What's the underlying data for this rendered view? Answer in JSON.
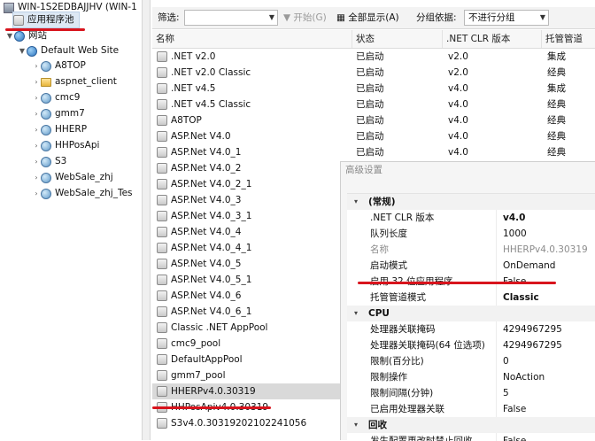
{
  "tree": {
    "server": "WIN-1S2EDBAJJHV (WIN-1",
    "app_pools": "应用程序池",
    "sites": "网站",
    "default_site": "Default Web Site",
    "children": [
      "A8TOP",
      "aspnet_client",
      "cmc9",
      "gmm7",
      "HHERP",
      "HHPosApi",
      "S3",
      "WebSale_zhj",
      "WebSale_zhj_Tes"
    ]
  },
  "toolbar": {
    "filter_label": "筛选:",
    "filter_value": "",
    "start_label": "开始(G)",
    "show_all_label": "全部显示(A)",
    "group_label": "分组依据:",
    "group_value": "不进行分组"
  },
  "columns": {
    "name": "名称",
    "status": "状态",
    "clr": ".NET CLR 版本",
    "pipeline": "托管管道"
  },
  "pools": [
    {
      "name": ".NET v2.0",
      "status": "已启动",
      "clr": "v2.0",
      "pipeline": "集成"
    },
    {
      "name": ".NET v2.0 Classic",
      "status": "已启动",
      "clr": "v2.0",
      "pipeline": "经典"
    },
    {
      "name": ".NET v4.5",
      "status": "已启动",
      "clr": "v4.0",
      "pipeline": "集成"
    },
    {
      "name": ".NET v4.5 Classic",
      "status": "已启动",
      "clr": "v4.0",
      "pipeline": "经典"
    },
    {
      "name": "A8TOP",
      "status": "已启动",
      "clr": "v4.0",
      "pipeline": "经典"
    },
    {
      "name": "ASP.Net V4.0",
      "status": "已启动",
      "clr": "v4.0",
      "pipeline": "经典"
    },
    {
      "name": "ASP.Net V4.0_1",
      "status": "已启动",
      "clr": "v4.0",
      "pipeline": "经典"
    },
    {
      "name": "ASP.Net V4.0_2"
    },
    {
      "name": "ASP.Net V4.0_2_1"
    },
    {
      "name": "ASP.Net V4.0_3"
    },
    {
      "name": "ASP.Net V4.0_3_1"
    },
    {
      "name": "ASP.Net V4.0_4"
    },
    {
      "name": "ASP.Net V4.0_4_1"
    },
    {
      "name": "ASP.Net V4.0_5"
    },
    {
      "name": "ASP.Net V4.0_5_1"
    },
    {
      "name": "ASP.Net V4.0_6"
    },
    {
      "name": "ASP.Net V4.0_6_1"
    },
    {
      "name": "Classic .NET AppPool"
    },
    {
      "name": "cmc9_pool"
    },
    {
      "name": "DefaultAppPool"
    },
    {
      "name": "gmm7_pool"
    },
    {
      "name": "HHERPv4.0.30319"
    },
    {
      "name": "HHPosApiv4.0.30319"
    },
    {
      "name": "S3v4.0.30319202102241056"
    }
  ],
  "selected_pool": "HHERPv4.0.30319",
  "properties": {
    "title": "高级设置",
    "general": {
      "label": "(常规)",
      "rows": [
        {
          "name": ".NET CLR 版本",
          "value": "v4.0"
        },
        {
          "name": "队列长度",
          "value": "1000"
        },
        {
          "name": "名称",
          "value": "HHERPv4.0.30319"
        },
        {
          "name": "启动模式",
          "value": "OnDemand"
        },
        {
          "name": "启用 32 位应用程序",
          "value": "False"
        },
        {
          "name": "托管管道模式",
          "value": "Classic"
        }
      ]
    },
    "cpu": {
      "label": "CPU",
      "rows": [
        {
          "name": "处理器关联掩码",
          "value": "4294967295"
        },
        {
          "name": "处理器关联掩码(64 位选项)",
          "value": "4294967295"
        },
        {
          "name": "限制(百分比)",
          "value": "0"
        },
        {
          "name": "限制操作",
          "value": "NoAction"
        },
        {
          "name": "限制间隔(分钟)",
          "value": "5"
        },
        {
          "name": "已启用处理器关联",
          "value": "False"
        }
      ]
    },
    "recycle": {
      "label": "回收",
      "rows": [
        {
          "name": "发生配置更改时禁止回收",
          "value": "False"
        }
      ]
    }
  },
  "colors": {
    "annotation": "#d8141d",
    "selection": "#d9d9d9"
  }
}
